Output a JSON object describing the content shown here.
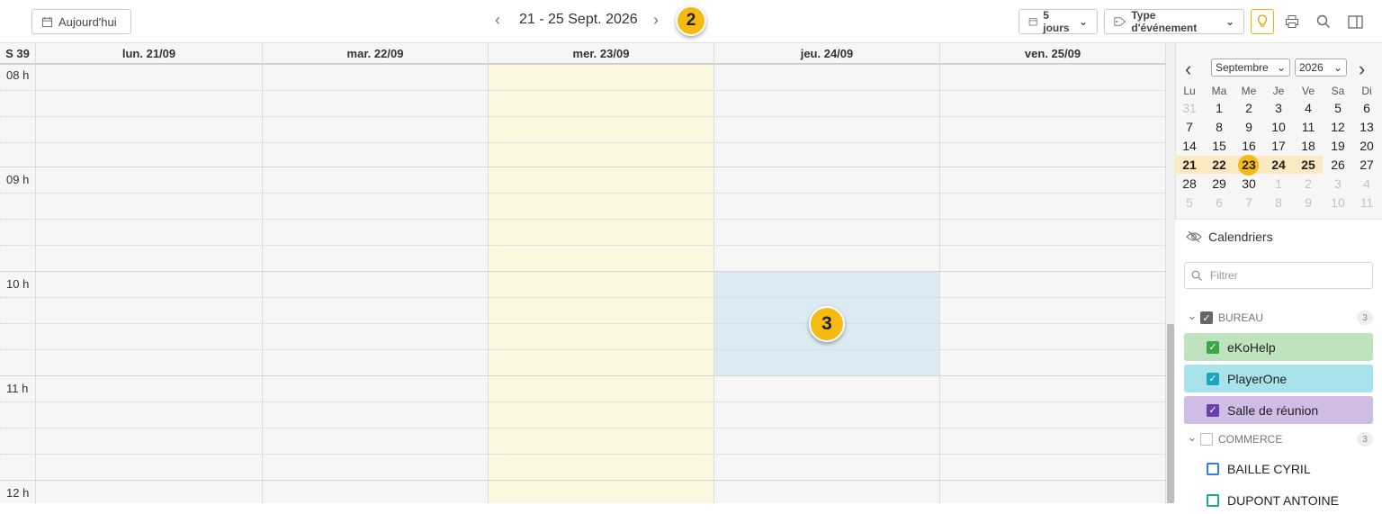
{
  "toolbar": {
    "today_label": "Aujourd'hui",
    "date_range": "21 - 25 Sept. 2026",
    "step_badge_top": "2",
    "view_select": "5 jours",
    "event_type_select": "Type d'événement"
  },
  "grid": {
    "week_label": "S 39",
    "days": [
      "lun. 21/09",
      "mar. 22/09",
      "mer. 23/09",
      "jeu. 24/09",
      "ven. 25/09"
    ],
    "today_index": 2,
    "hours": [
      "08 h",
      "09 h",
      "10 h",
      "11 h",
      "12 h"
    ],
    "selection": {
      "day": "jeu. 24/09",
      "start": "10 h",
      "end": "11 h"
    },
    "step_badge_selection": "3"
  },
  "minical": {
    "month": "Septembre",
    "year": "2026",
    "dow": [
      "Lu",
      "Ma",
      "Me",
      "Je",
      "Ve",
      "Sa",
      "Di"
    ],
    "weeks": [
      [
        "31",
        "1",
        "2",
        "3",
        "4",
        "5",
        "6"
      ],
      [
        "7",
        "8",
        "9",
        "10",
        "11",
        "12",
        "13"
      ],
      [
        "14",
        "15",
        "16",
        "17",
        "18",
        "19",
        "20"
      ],
      [
        "21",
        "22",
        "23",
        "24",
        "25",
        "26",
        "27"
      ],
      [
        "28",
        "29",
        "30",
        "1",
        "2",
        "3",
        "4"
      ],
      [
        "5",
        "6",
        "7",
        "8",
        "9",
        "10",
        "11"
      ]
    ],
    "selected_day": "23"
  },
  "calendars": {
    "title": "Calendriers",
    "filter_placeholder": "Filtrer",
    "groups": [
      {
        "name": "BUREAU",
        "count": "3",
        "items": [
          {
            "label": "eKoHelp",
            "color": "#bfe3bf",
            "check": "#3aa845"
          },
          {
            "label": "PlayerOne",
            "color": "#a8e3ec",
            "check": "#17a7c2"
          },
          {
            "label": "Salle de réunion",
            "color": "#cfbde6",
            "check": "#6b3fb0"
          }
        ]
      },
      {
        "name": "COMMERCE",
        "count": "3",
        "items": [
          {
            "label": "BAILLE CYRIL",
            "color": "#ffffff",
            "check": "#2e7fd6"
          },
          {
            "label": "DUPONT ANTOINE",
            "color": "#ffffff",
            "check": "#18a89a"
          }
        ]
      }
    ]
  },
  "colors": {
    "accent": "#f5bb14",
    "today_column": "#fcf7df",
    "selection": "#dcebf1"
  }
}
